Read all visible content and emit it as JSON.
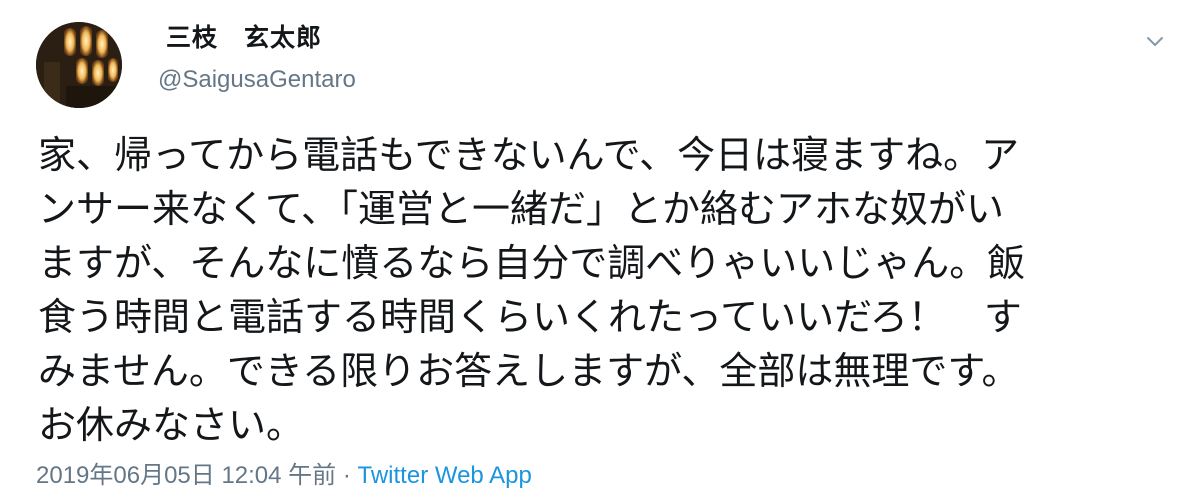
{
  "user": {
    "display_name": "三枝　玄太郎",
    "handle": "@SaigusaGentaro",
    "avatar_icon": "avatar-lights-icon"
  },
  "tweet": {
    "lines": [
      "家、帰ってから電話もできないんで、今日は寝ますね。ア",
      "ンサー来なくて、「運営と一緒だ」とか絡むアホな奴がい",
      "ますが、そんなに憤るなら自分で調べりゃいいじゃん。飯",
      "食う時間と電話する時間くらいくれたっていいだろ！　す",
      "みません。できる限りお答えしますが、全部は無理です。",
      "お休みなさい。"
    ]
  },
  "meta": {
    "timestamp": "2019年06月05日 12:04 午前",
    "separator": " · ",
    "source": "Twitter Web App"
  },
  "icons": {
    "menu": "chevron-down-icon"
  },
  "colors": {
    "text": "#14171a",
    "secondary": "#657786",
    "link": "#1b95e0"
  }
}
